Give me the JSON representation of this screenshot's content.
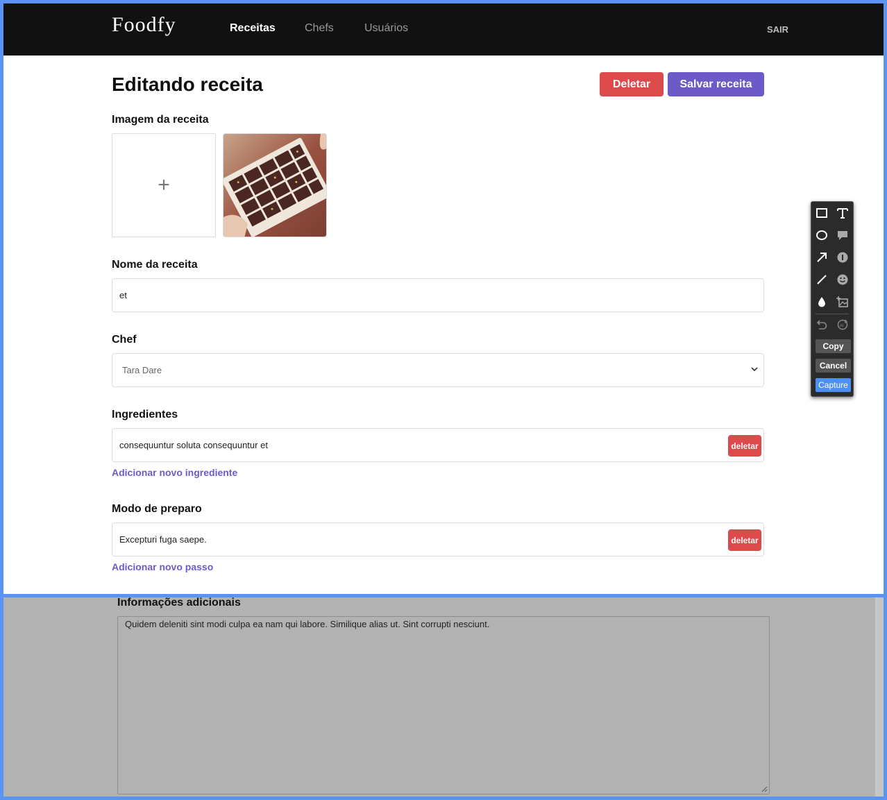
{
  "header": {
    "logo": "Foodfy",
    "nav": [
      "Receitas",
      "Chefs",
      "Usuários"
    ],
    "active_nav": "Receitas",
    "logout": "SAIR"
  },
  "page": {
    "title": "Editando receita",
    "delete_button": "Deletar",
    "save_button": "Salvar receita"
  },
  "form": {
    "image_label": "Imagem da receita",
    "image_add_symbol": "+",
    "name_label": "Nome da receita",
    "name_value": "et",
    "chef_label": "Chef",
    "chef_value": "Tara Dare",
    "ingredients_label": "Ingredientes",
    "ingredients": [
      "consequuntur soluta consequuntur et"
    ],
    "add_ingredient": "Adicionar novo ingrediente",
    "steps_label": "Modo de preparo",
    "steps": [
      "Excepturi fuga saepe."
    ],
    "add_step": "Adicionar novo passo",
    "delete_item": "deletar",
    "info_label": "Informações adicionais",
    "info_value": "Quidem deleniti sint modi culpa ea nam qui labore. Similique alias ut. Sint corrupti nesciunt."
  },
  "capture_toolbar": {
    "tools": [
      "rectangle-icon",
      "text-icon",
      "ellipse-icon",
      "speech-bubble-icon",
      "arrow-icon",
      "number-marker-icon",
      "pencil-icon",
      "emoji-icon",
      "blur-drop-icon",
      "image-insert-icon",
      "undo-icon",
      "redo-icon"
    ],
    "copy": "Copy",
    "cancel": "Cancel",
    "capture": "Capture"
  },
  "colors": {
    "header_bg": "#111111",
    "accent_purple": "#6d5ac6",
    "danger_red": "#dc4a4b",
    "capture_border": "#5b93f0"
  }
}
